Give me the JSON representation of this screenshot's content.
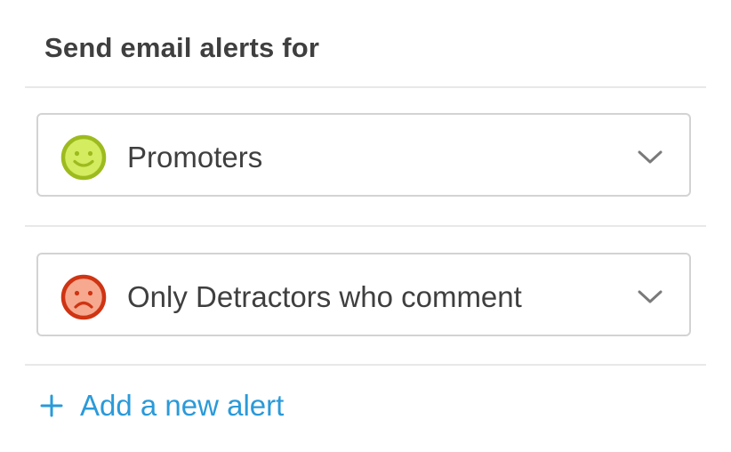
{
  "section": {
    "title": "Send email alerts for"
  },
  "alerts": [
    {
      "label": "Promoters",
      "icon": "happy-face-icon",
      "icon_color": "#9dbb1f",
      "icon_fill": "#d4ec5f"
    },
    {
      "label": "Only Detractors who comment",
      "icon": "sad-face-icon",
      "icon_color": "#cf3413",
      "icon_fill": "#f6a98f"
    }
  ],
  "add_alert": {
    "label": "Add a new alert",
    "icon": "plus-icon",
    "color": "#2a9ad9"
  },
  "dropdown_icon": "chevron-down-icon"
}
